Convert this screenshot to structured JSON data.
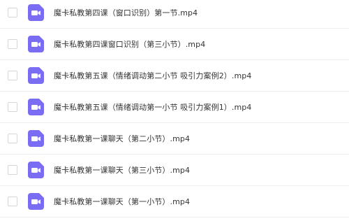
{
  "colors": {
    "video_icon_bg": "#7b6cf4",
    "video_icon_fg": "#ffffff",
    "row_divider": "#eeeeee",
    "text": "#333333"
  },
  "files": [
    {
      "name": "魔卡私教第四课（窗口识别）第一节.mp4",
      "icon": "video-file-icon",
      "checked": false
    },
    {
      "name": "魔卡私教第四课窗口识别（第三小节）.mp4",
      "icon": "video-file-icon",
      "checked": false
    },
    {
      "name": "魔卡私教第五课（情绪调动第二小节 吸引力案例2）.mp4",
      "icon": "video-file-icon",
      "checked": false
    },
    {
      "name": "魔卡私教第五课（情绪调动第一小节 吸引力案例1）.mp4",
      "icon": "video-file-icon",
      "checked": false
    },
    {
      "name": "魔卡私教第一课聊天（第二小节）.mp4",
      "icon": "video-file-icon",
      "checked": false
    },
    {
      "name": "魔卡私教第一课聊天（第三小节）.mp4",
      "icon": "video-file-icon",
      "checked": false
    },
    {
      "name": "魔卡私教第一课聊天（第一小节）.mp4",
      "icon": "video-file-icon",
      "checked": false
    }
  ]
}
